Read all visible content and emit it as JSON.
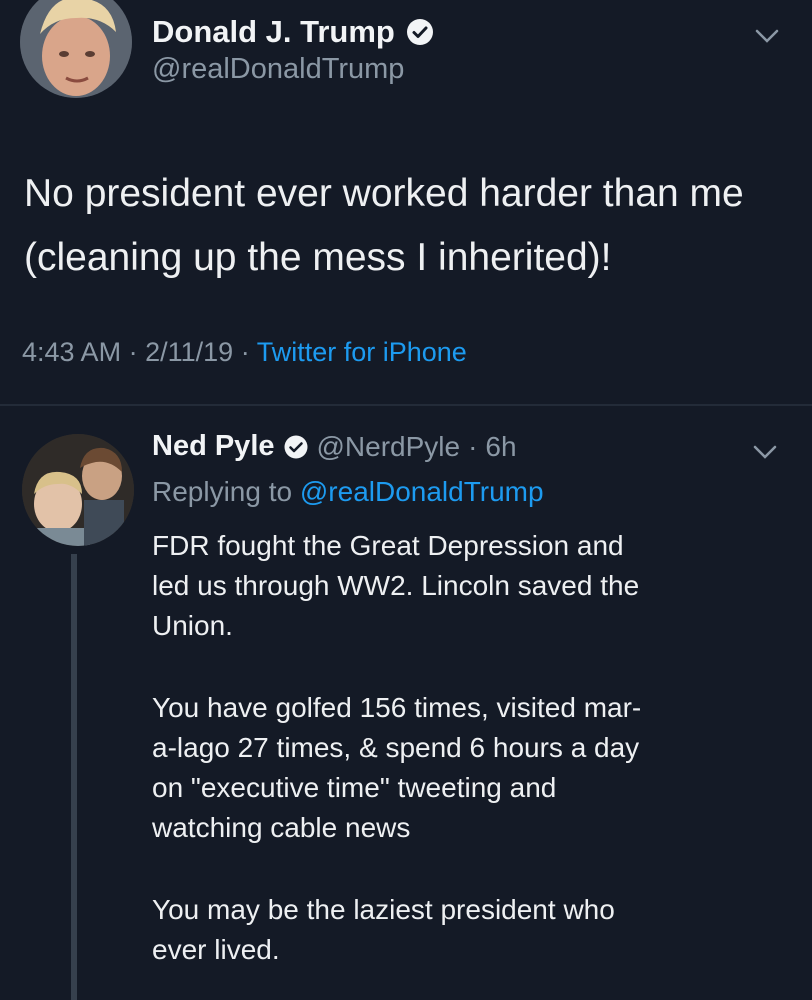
{
  "main_tweet": {
    "author_name": "Donald J. Trump",
    "author_handle": "@realDonaldTrump",
    "verified_icon": "verified-badge-icon",
    "text": "No president ever worked harder than me (cleaning up the mess I inherited)!",
    "time": "4:43 AM",
    "date": "2/11/19",
    "separator": "·",
    "source": "Twitter for iPhone",
    "menu_icon": "chevron-down-icon"
  },
  "reply_tweet": {
    "author_name": "Ned Pyle",
    "author_handle": "@NerdPyle",
    "separator": "·",
    "age": "6h",
    "verified_icon": "verified-badge-icon",
    "replying_to_label": "Replying to",
    "replying_to_handle": "@realDonaldTrump",
    "paragraphs": [
      "FDR fought the Great Depression  and\nled us through WW2. Lincoln saved the\nUnion.",
      "You have golfed 156 times, visited mar-\na-lago 27 times, & spend 6 hours a day\non \"executive time\" tweeting and\nwatching cable news",
      "You may be the laziest president who\never lived."
    ],
    "menu_icon": "chevron-down-icon"
  },
  "colors": {
    "background": "#141a26",
    "link_blue": "#1d9bf0",
    "muted_text": "#8b98a5"
  }
}
